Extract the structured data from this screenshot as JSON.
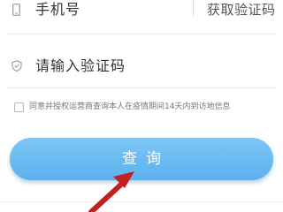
{
  "form": {
    "phone_placeholder": "手机号",
    "get_code_label": "获取验证码",
    "code_placeholder": "请输入验证码",
    "agreement_text": "同意并授权运营商查询本人在疫情期间14天内到访地信息",
    "submit_label": "查询"
  },
  "icons": {
    "phone": "phone-icon",
    "shield": "shield-check-icon"
  },
  "colors": {
    "button": "#6dbcf2",
    "arrow": "#c0221e"
  }
}
